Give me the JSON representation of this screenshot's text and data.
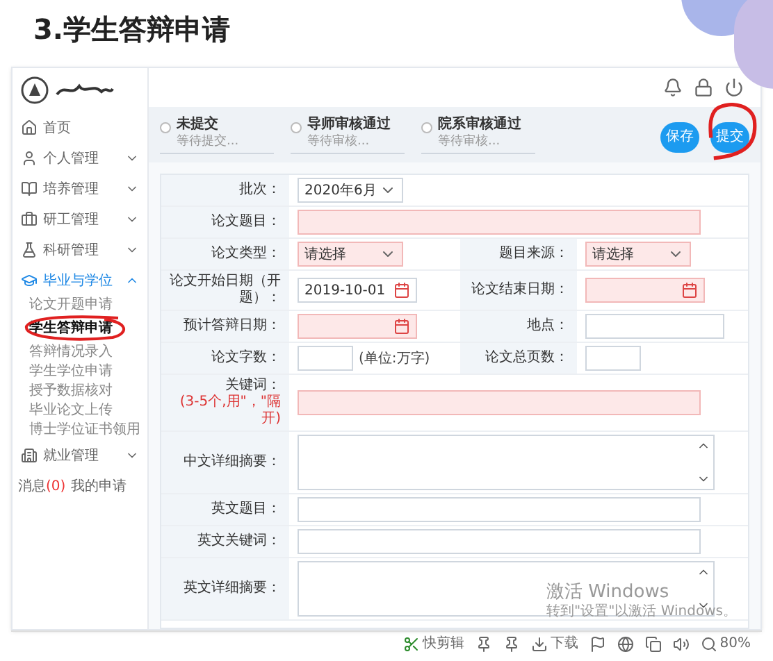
{
  "slide_title": "3.学生答辩申请",
  "sidebar": {
    "items": [
      {
        "label": "首页",
        "kind": "link"
      },
      {
        "label": "个人管理",
        "kind": "group",
        "expanded": false
      },
      {
        "label": "培养管理",
        "kind": "group",
        "expanded": false
      },
      {
        "label": "研工管理",
        "kind": "group",
        "expanded": false
      },
      {
        "label": "科研管理",
        "kind": "group",
        "expanded": false
      },
      {
        "label": "毕业与学位",
        "kind": "group",
        "expanded": true,
        "children": [
          {
            "label": "论文开题申请",
            "selected": false
          },
          {
            "label": "学生答辩申请",
            "selected": true
          },
          {
            "label": "答辩情况录入",
            "selected": false
          },
          {
            "label": "学生学位申请",
            "selected": false
          },
          {
            "label": "授予数据核对",
            "selected": false
          },
          {
            "label": "毕业论文上传",
            "selected": false
          },
          {
            "label": "博士学位证书领用",
            "selected": false
          }
        ]
      },
      {
        "label": "就业管理",
        "kind": "group",
        "expanded": false
      }
    ],
    "footer": [
      {
        "label": "消息",
        "count": "(0)"
      },
      {
        "label": "我的申请"
      }
    ]
  },
  "steps": [
    {
      "title": "未提交",
      "subtitle": "等待提交..."
    },
    {
      "title": "导师审核通过",
      "subtitle": "等待审核..."
    },
    {
      "title": "院系审核通过",
      "subtitle": "等待审核..."
    }
  ],
  "buttons": [
    {
      "label": "保存"
    },
    {
      "label": "提交"
    }
  ],
  "form": {
    "rows": [
      {
        "fields": [
          {
            "label": "批次：",
            "kind": "select",
            "value": "2020年6月",
            "required": false
          }
        ]
      },
      {
        "fields": [
          {
            "label": "论文题目：",
            "kind": "input",
            "required": true
          }
        ]
      },
      {
        "fields": [
          {
            "label": "论文类型：",
            "kind": "select",
            "value": "请选择",
            "required": true
          },
          {
            "label": "题目来源：",
            "kind": "select",
            "value": "请选择",
            "required": true
          }
        ]
      },
      {
        "fields": [
          {
            "label": "论文开始日期（开题）：",
            "kind": "date",
            "value": "2019-10-01",
            "required": false
          },
          {
            "label": "论文结束日期：",
            "kind": "date",
            "required": true
          }
        ]
      },
      {
        "fields": [
          {
            "label": "预计答辩日期：",
            "kind": "date",
            "required": true
          },
          {
            "label": "地点：",
            "kind": "input",
            "required": false
          }
        ]
      },
      {
        "fields": [
          {
            "label": "论文字数：",
            "kind": "number",
            "unit": "(单位:万字)",
            "required": false
          },
          {
            "label": "论文总页数：",
            "kind": "number",
            "required": false
          }
        ]
      },
      {
        "fields": [
          {
            "label": "关键词：",
            "note": "(3-5个,用\"，\"隔开)",
            "kind": "input",
            "required": true
          }
        ]
      },
      {
        "fields": [
          {
            "label": "中文详细摘要：",
            "kind": "textarea",
            "required": false
          }
        ]
      },
      {
        "fields": [
          {
            "label": "英文题目：",
            "kind": "input",
            "required": false
          }
        ]
      },
      {
        "fields": [
          {
            "label": "英文关键词：",
            "kind": "input",
            "required": false
          }
        ]
      },
      {
        "fields": [
          {
            "label": "英文详细摘要：",
            "kind": "textarea",
            "required": false
          }
        ]
      }
    ]
  },
  "activation_notice": {
    "title": "激活 Windows",
    "subtitle": "转到\"设置\"以激活 Windows。"
  },
  "status_bar": {
    "items": [
      {
        "label": "快剪辑",
        "kind": "app"
      },
      {
        "kind": "icon"
      },
      {
        "kind": "icon"
      },
      {
        "label": "下载",
        "kind": "download"
      },
      {
        "kind": "icon"
      },
      {
        "kind": "icon"
      },
      {
        "kind": "icon"
      },
      {
        "kind": "icon"
      },
      {
        "label": "80%",
        "kind": "zoom"
      }
    ]
  }
}
